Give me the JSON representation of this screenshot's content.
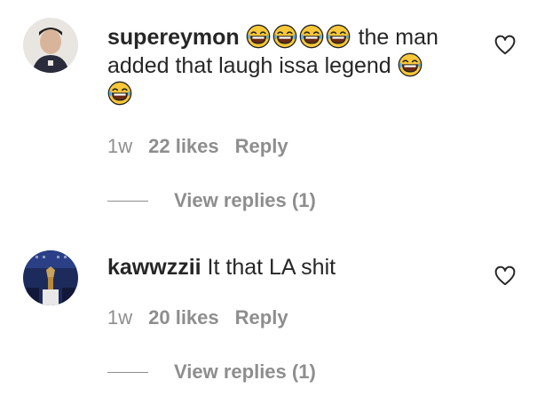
{
  "comments": [
    {
      "username": "supereymon",
      "text_after_emojis": "the man",
      "text_line2": "added that laugh issa legend",
      "time": "1w",
      "likes": "22 likes",
      "reply_label": "Reply",
      "view_replies": "View replies (1)",
      "emoji": "face-with-tears-of-joy"
    },
    {
      "username": "kawwzzii",
      "text": "It that LA shit",
      "time": "1w",
      "likes": "20 likes",
      "reply_label": "Reply",
      "view_replies": "View replies (1)"
    }
  ],
  "colors": {
    "text": "#262626",
    "secondary": "#8e8e8e",
    "emoji": "#f7c52f"
  }
}
